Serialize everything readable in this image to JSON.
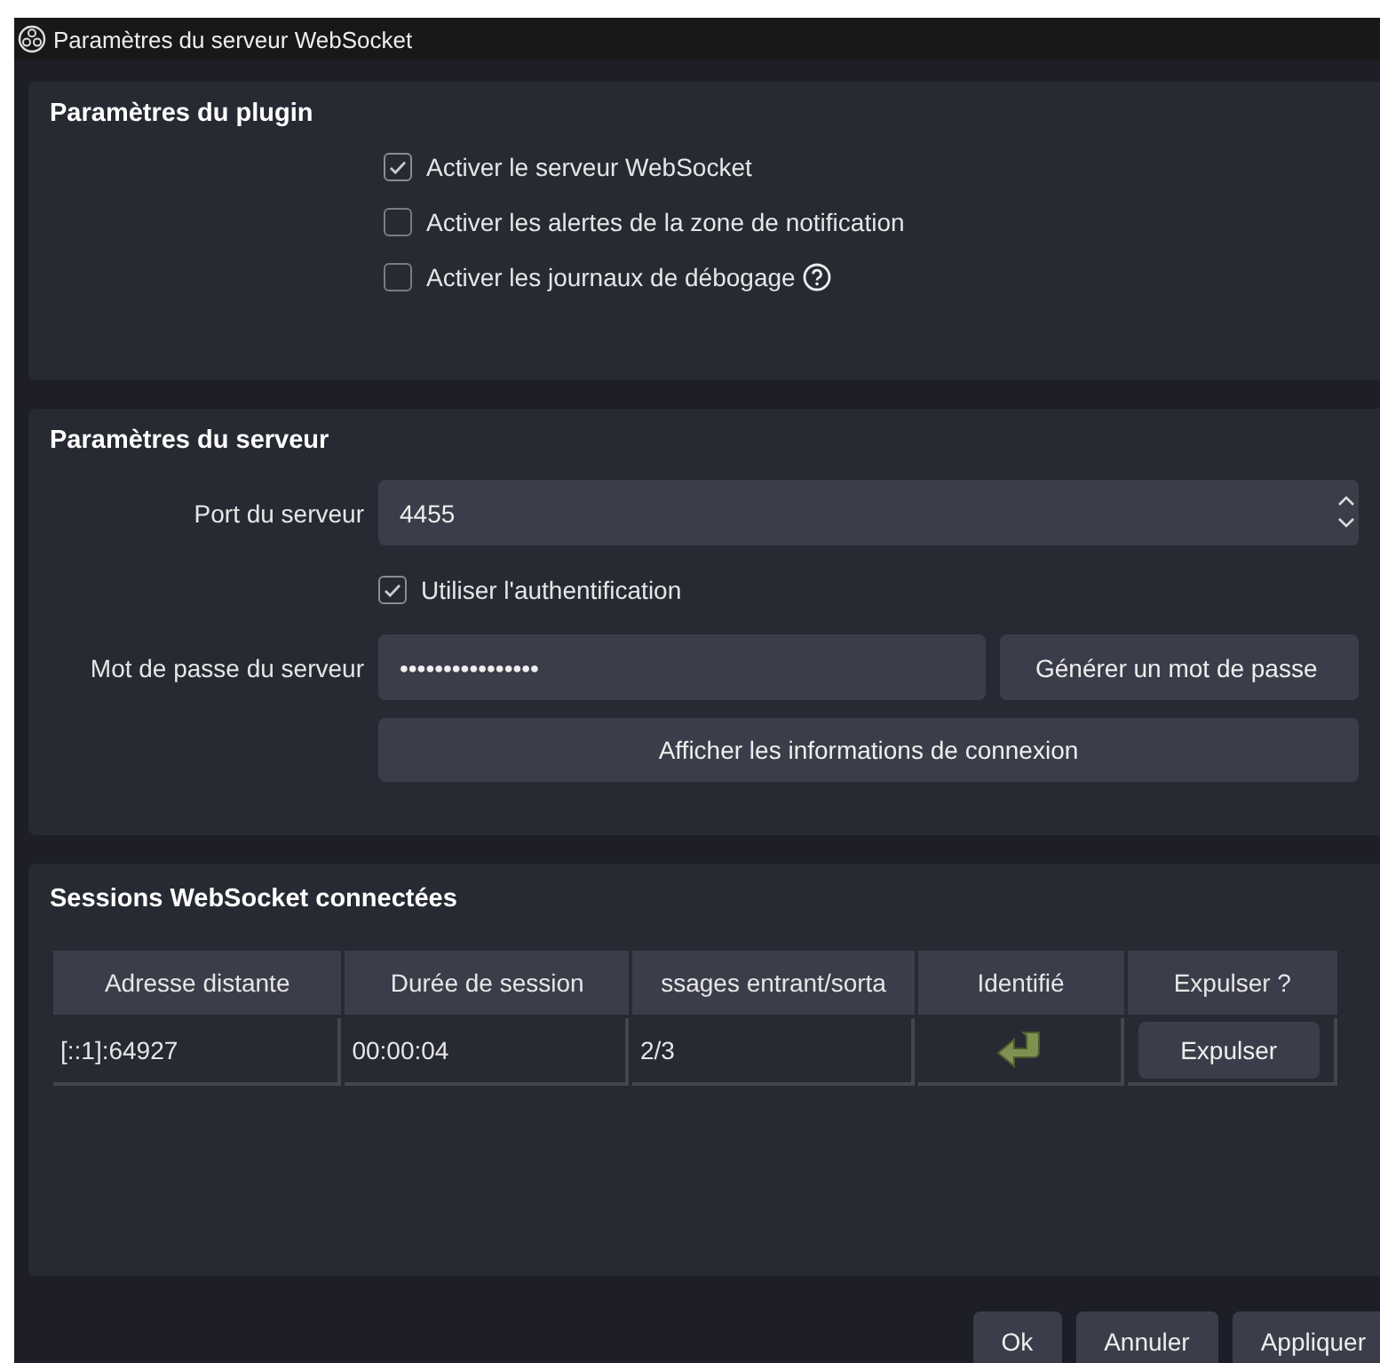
{
  "window": {
    "title": "Paramètres du serveur WebSocket"
  },
  "plugin_settings": {
    "title": "Paramètres du plugin",
    "options": [
      {
        "label": "Activer le serveur WebSocket",
        "checked": true,
        "help": false
      },
      {
        "label": "Activer les alertes de la zone de notification",
        "checked": false,
        "help": false
      },
      {
        "label": "Activer les journaux de débogage",
        "checked": false,
        "help": true
      }
    ]
  },
  "server_settings": {
    "title": "Paramètres du serveur",
    "port_label": "Port du serveur",
    "port_value": "4455",
    "auth": {
      "label": "Utiliser l'authentification",
      "checked": true
    },
    "password_label": "Mot de passe du serveur",
    "password_value": "••••••••••••••••",
    "generate_button": "Générer un mot de passe",
    "show_info_button": "Afficher les informations de connexion"
  },
  "sessions": {
    "title": "Sessions WebSocket connectées",
    "columns": [
      "Adresse distante",
      "Durée de session",
      "ssages entrant/sorta",
      "Identifié",
      "Expulser ?"
    ],
    "rows": [
      {
        "address": "[::1]:64927",
        "duration": "00:00:04",
        "messages": "2/3",
        "identified": true,
        "kick_button": "Expulser"
      }
    ]
  },
  "buttons": [
    "Ok",
    "Annuler",
    "Appliquer"
  ]
}
